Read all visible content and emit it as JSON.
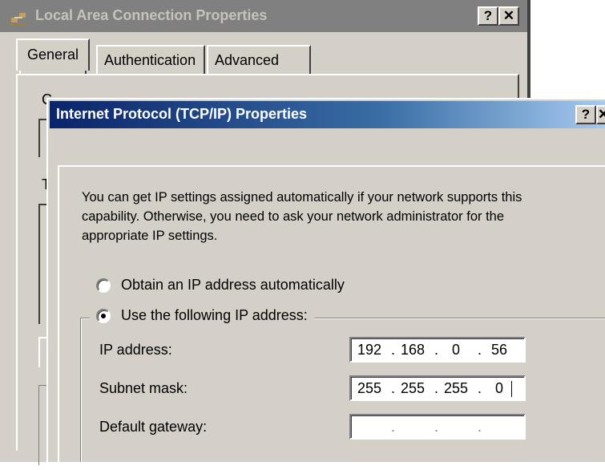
{
  "background_dialog": {
    "title": "Local Area Connection Properties",
    "help_button": "?",
    "close_button": "✕",
    "tabs": [
      {
        "label": "General"
      },
      {
        "label": "Authentication"
      },
      {
        "label": "Advanced"
      }
    ],
    "peek_label_1": "C",
    "peek_label_2": "T"
  },
  "dialog": {
    "title": "Internet Protocol (TCP/IP) Properties",
    "help_button": "?",
    "close_button": "✕",
    "tab": "General",
    "description": "You can get IP settings assigned automatically if your network supports this capability. Otherwise, you need to ask your network administrator for the appropriate IP settings.",
    "radio_auto": "Obtain an IP address automatically",
    "radio_manual": "Use the following IP address:",
    "selected_option": "manual",
    "fields": {
      "ip": {
        "label": "IP address:",
        "octets": [
          "192",
          "168",
          "0",
          "56"
        ]
      },
      "mask": {
        "label": "Subnet mask:",
        "octets": [
          "255",
          "255",
          "255",
          "0"
        ]
      },
      "gateway": {
        "label": "Default gateway:",
        "octets": [
          "",
          "",
          "",
          ""
        ]
      }
    }
  }
}
